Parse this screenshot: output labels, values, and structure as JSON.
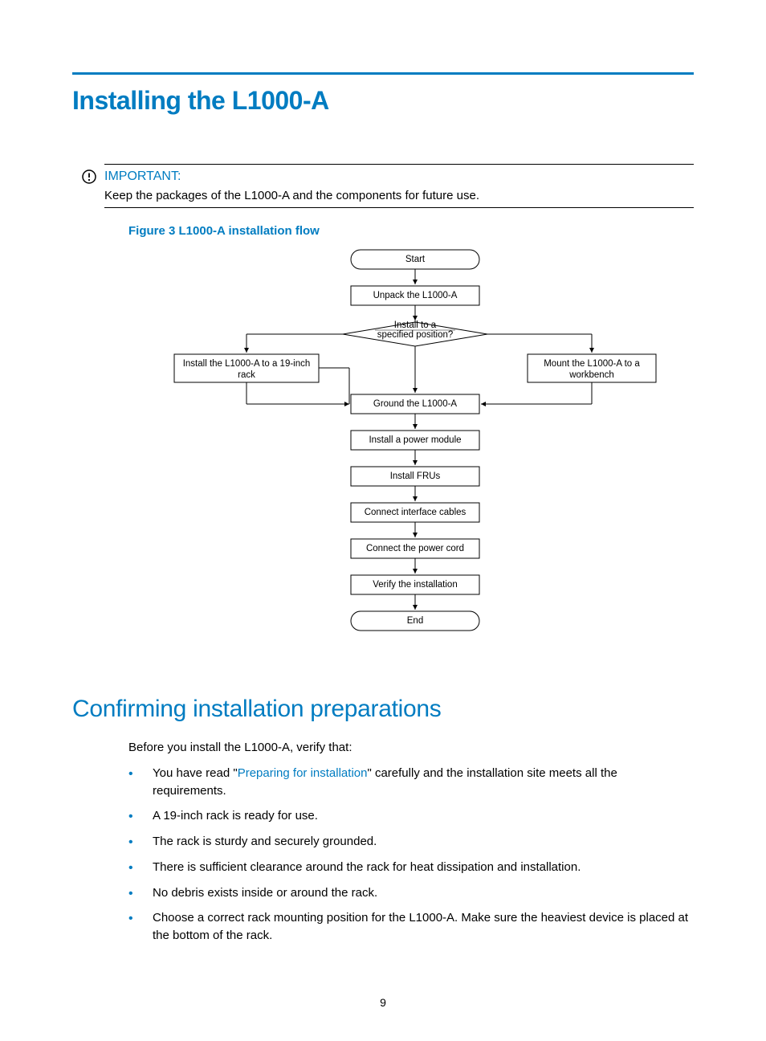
{
  "title": "Installing the L1000-A",
  "important": {
    "heading": "IMPORTANT:",
    "text": "Keep the packages of the L1000-A and the components for future use."
  },
  "figure_caption": "Figure 3 L1000-A installation flow",
  "flow": {
    "start": "Start",
    "unpack": "Unpack the L1000-A",
    "decision": "Install to a specified position?",
    "rack": [
      "Install the L1000-A to a 19-inch",
      "rack"
    ],
    "workbench": [
      "Mount the L1000-A to a",
      "workbench"
    ],
    "ground": "Ground the L1000-A",
    "power_module": "Install a power module",
    "frus": "Install FRUs",
    "cables": "Connect interface cables",
    "cord": "Connect the power cord",
    "verify": "Verify the installation",
    "end": "End"
  },
  "section2": "Confirming installation preparations",
  "intro": "Before you install the L1000-A, verify that:",
  "bullets": [
    {
      "pre": "You have read \"",
      "link": "Preparing for installation",
      "post": "\" carefully and the installation site meets all the requirements."
    },
    {
      "text": "A 19-inch rack is ready for use."
    },
    {
      "text": "The rack is sturdy and securely grounded."
    },
    {
      "text": "There is sufficient clearance around the rack for heat dissipation and installation."
    },
    {
      "text": "No debris exists inside or around the rack."
    },
    {
      "text": "Choose a correct rack mounting position for the L1000-A. Make sure the heaviest device is placed at the bottom of the rack."
    }
  ],
  "page_number": "9"
}
